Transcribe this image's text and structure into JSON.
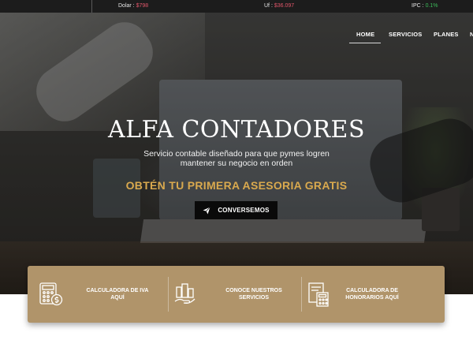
{
  "ticker": {
    "dolar": {
      "label": "Dolar :",
      "value": "$798",
      "color": "#e0566a"
    },
    "uf": {
      "label": "Uf :",
      "value": "$36.097",
      "color": "#e0566a"
    },
    "ipc": {
      "label": "IPC :",
      "value": "0.1%",
      "color": "#3cba5a"
    }
  },
  "nav": {
    "items": [
      {
        "label": "HOME",
        "active": true
      },
      {
        "label": "SERVICIOS"
      },
      {
        "label": "PLANES"
      },
      {
        "label": "N"
      }
    ]
  },
  "hero": {
    "title": "ALFA CONTADORES",
    "subtitle": "Servicio contable diseñado para que pymes logren mantener su negocio en orden",
    "cta_text": "OBTÉN TU PRIMERA ASESORIA GRATIS",
    "button_label": "CONVERSEMOS",
    "cta_color": "#d9a94e"
  },
  "features": {
    "background": "#b0946a",
    "items": [
      {
        "label": "CALCULADORA DE IVA AQUÍ",
        "icon": "calculator-dollar-icon"
      },
      {
        "label": "CONOCE NUESTROS SERVICIOS",
        "icon": "buildings-hand-icon"
      },
      {
        "label": "CALCULADORA DE HONORARIOS AQUÍ",
        "icon": "document-calculator-icon"
      }
    ]
  }
}
